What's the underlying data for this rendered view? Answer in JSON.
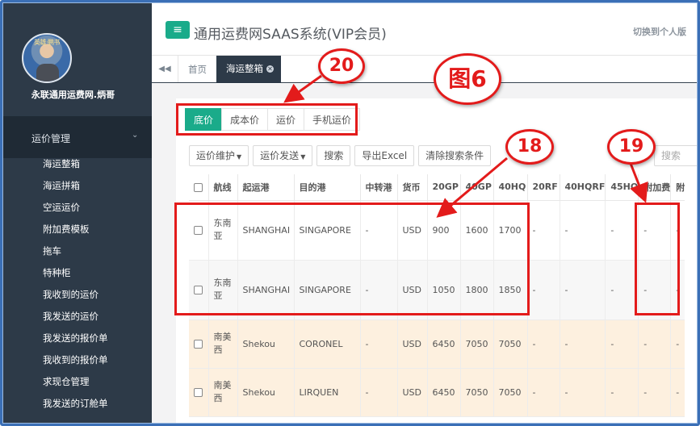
{
  "sidebar": {
    "avatar_stamp": "英雄·鹏书",
    "username": "永联通用运费网.炳哥",
    "menu_head": "运价管理",
    "items": [
      {
        "label": "海运整箱"
      },
      {
        "label": "海运拼箱"
      },
      {
        "label": "空运运价"
      },
      {
        "label": "附加费模板"
      },
      {
        "label": "拖车"
      },
      {
        "label": "特种柜"
      },
      {
        "label": "我收到的运价"
      },
      {
        "label": "我发送的运价"
      },
      {
        "label": "我发送的报价单"
      },
      {
        "label": "我收到的报价单"
      },
      {
        "label": "求现仓管理"
      },
      {
        "label": "我发送的订舱单"
      }
    ]
  },
  "header": {
    "menu_icon": "≡",
    "title": "通用运费网SAAS系统(VIP会员)",
    "switch_label": "切换到个人版"
  },
  "tabs": {
    "back_icon": "◀◀",
    "home": "首页",
    "active": "海运整箱",
    "close_icon": "✕"
  },
  "price_tabs": [
    "底价",
    "成本价",
    "运价",
    "手机运价"
  ],
  "toolbar": {
    "maintain": "运价维护",
    "send": "运价发送",
    "search": "搜索",
    "export": "导出Excel",
    "clear": "清除搜索条件",
    "search_placeholder": "搜索"
  },
  "table": {
    "columns": [
      "航线",
      "起运港",
      "目的港",
      "中转港",
      "货币",
      "20GP",
      "40GP",
      "40HQ",
      "20RF",
      "40HQRF",
      "45HQ",
      "附加费",
      "附"
    ],
    "rows": [
      [
        "东南亚",
        "SHANGHAI",
        "SINGAPORE",
        "-",
        "USD",
        "900",
        "1600",
        "1700",
        "-",
        "-",
        "-",
        "-",
        "-"
      ],
      [
        "东南亚",
        "SHANGHAI",
        "SINGAPORE",
        "-",
        "USD",
        "1050",
        "1800",
        "1850",
        "-",
        "-",
        "-",
        "-",
        "-"
      ],
      [
        "南美西",
        "Shekou",
        "CORONEL",
        "-",
        "USD",
        "6450",
        "7050",
        "7050",
        "-",
        "-",
        "-",
        "-",
        "-"
      ],
      [
        "南美西",
        "Shekou",
        "LIRQUEN",
        "-",
        "USD",
        "6450",
        "7050",
        "7050",
        "-",
        "-",
        "-",
        "-",
        "-"
      ]
    ]
  },
  "annotations": {
    "figure_label": "图6",
    "label_20": "20",
    "label_18": "18",
    "label_19": "19"
  },
  "colors": {
    "accent": "#1aab8a",
    "sidebar": "#2d3a48",
    "annotation": "#e31b1b",
    "highlight_row": "#fdf0df"
  }
}
